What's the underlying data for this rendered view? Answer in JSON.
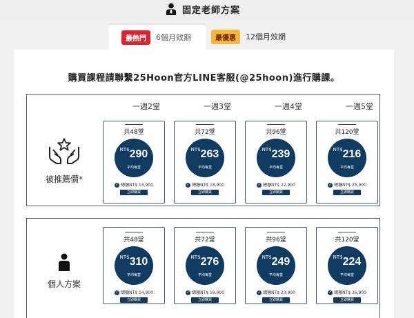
{
  "header": {
    "title": "固定老師方案",
    "icon": "person-tie-icon"
  },
  "tabs": [
    {
      "badge": "最熱門",
      "label": "6個月效期",
      "badge_color": "#d9232e",
      "active": true
    },
    {
      "badge": "最優惠",
      "label": "12個月效期",
      "badge_color": "#f5b83a",
      "active": false
    }
  ],
  "notice": "購買課程請聯繫25Hoon官方LINE客服(@25hoon)進行購課。",
  "columns": [
    "一週2堂",
    "一週3堂",
    "一週4堂",
    "一週5堂"
  ],
  "plans": [
    {
      "label": "被推薦價*",
      "icon": "hands-star-icon",
      "cards": [
        {
          "count": "共48堂",
          "currency": "NT$",
          "price": "290",
          "avg": "平均每堂",
          "total": "總額NT$ 13,900",
          "buy": "立即購買"
        },
        {
          "count": "共72堂",
          "currency": "NT$",
          "price": "263",
          "avg": "平均每堂",
          "total": "總額NT$ 18,900",
          "buy": "立即購買"
        },
        {
          "count": "共96堂",
          "currency": "NT$",
          "price": "239",
          "avg": "平均每堂",
          "total": "總額NT$ 22,900",
          "buy": "立即購買"
        },
        {
          "count": "共120堂",
          "currency": "NT$",
          "price": "216",
          "avg": "平均每堂",
          "total": "總額NT$ 25,900",
          "buy": "立即購買"
        }
      ]
    },
    {
      "label": "個人方案",
      "icon": "person-icon",
      "cards": [
        {
          "count": "共48堂",
          "currency": "NT$",
          "price": "310",
          "avg": "平均每堂",
          "total": "總額NT$ 14,900",
          "buy": "立即購買"
        },
        {
          "count": "共72堂",
          "currency": "NT$",
          "price": "276",
          "avg": "平均每堂",
          "total": "總額NT$ 19,900",
          "buy": "立即購買"
        },
        {
          "count": "共96堂",
          "currency": "NT$",
          "price": "249",
          "avg": "平均每堂",
          "total": "總額NT$ 23,900",
          "buy": "立即購買"
        },
        {
          "count": "共120堂",
          "currency": "NT$",
          "price": "224",
          "avg": "平均每堂",
          "total": "總額NT$ 26,900",
          "buy": "立即購買"
        }
      ]
    }
  ],
  "colors": {
    "navy": "#0f3b61",
    "badge_red": "#d9232e",
    "badge_yellow": "#f5b83a"
  }
}
